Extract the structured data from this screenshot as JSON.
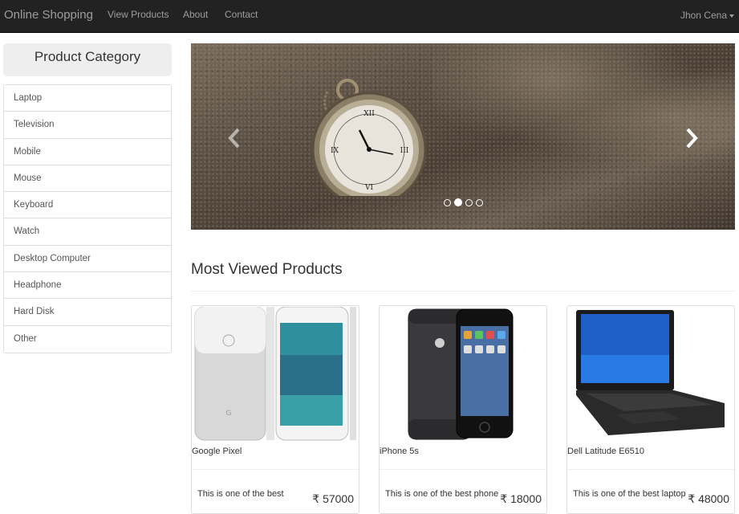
{
  "navbar": {
    "brand": "Online Shopping",
    "links": [
      "View Products",
      "About",
      "Contact"
    ],
    "user": "Jhon Cena"
  },
  "sidebar": {
    "title": "Product Category",
    "items": [
      "Laptop",
      "Television",
      "Mobile",
      "Mouse",
      "Keyboard",
      "Watch",
      "Desktop Computer",
      "Headphone",
      "Hard Disk",
      "Other"
    ]
  },
  "carousel": {
    "slide_count": 4,
    "active_index": 1
  },
  "section": {
    "title": "Most Viewed Products"
  },
  "products": [
    {
      "name": "Google Pixel",
      "description": "This is one of the best",
      "price": "₹ 57000"
    },
    {
      "name": "iPhone 5s",
      "description": "This is one of the best phone",
      "price": "₹ 18000"
    },
    {
      "name": "Dell Latitude E6510",
      "description": "This is one of the best laptop",
      "price": "₹ 48000"
    }
  ],
  "colors": {
    "navbar_bg": "#222222",
    "navbar_text": "#9d9d9d",
    "category_header_bg": "#eeeeee"
  }
}
